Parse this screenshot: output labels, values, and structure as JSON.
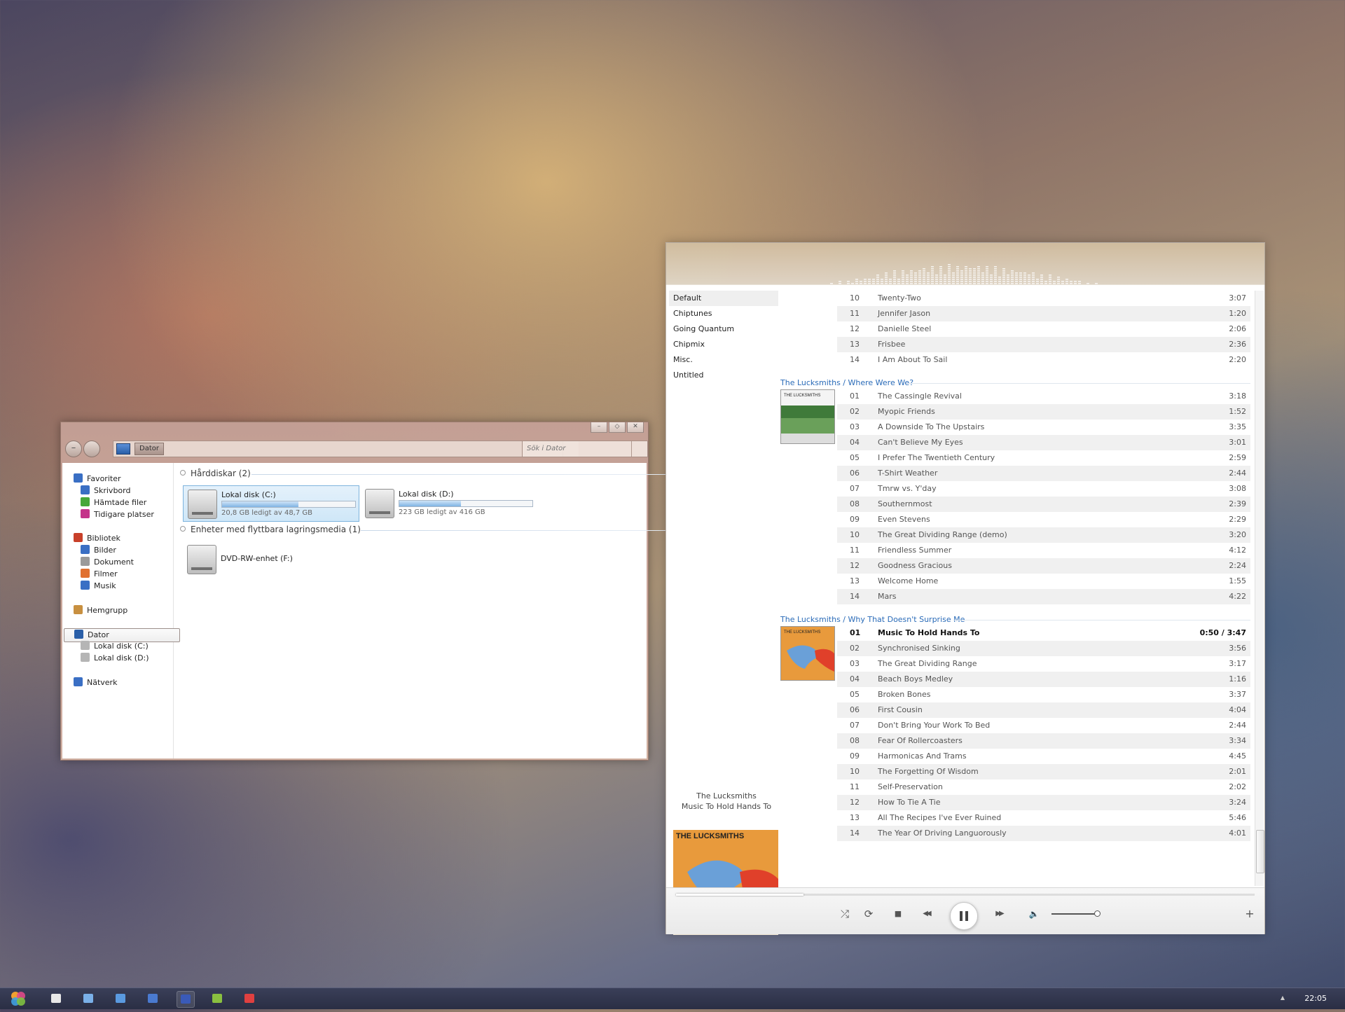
{
  "explorer": {
    "window_buttons": [
      "–",
      "◇",
      "✕"
    ],
    "breadcrumb": "Dator",
    "search_placeholder": "Sök i Dator",
    "nav": [
      {
        "label": "Favoriter",
        "icon": "star-icon",
        "color": "#3a6fc4",
        "indent": false
      },
      {
        "label": "Skrivbord",
        "icon": "desktop-icon",
        "color": "#3a6fc4",
        "indent": true
      },
      {
        "label": "Hämtade filer",
        "icon": "download-icon",
        "color": "#46a83a",
        "indent": true
      },
      {
        "label": "Tidigare platser",
        "icon": "recent-places-icon",
        "color": "#c4338a",
        "indent": true
      },
      {
        "label": "Bibliotek",
        "icon": "library-icon",
        "color": "#c8402a",
        "indent": false
      },
      {
        "label": "Bilder",
        "icon": "pictures-icon",
        "color": "#3a6fc4",
        "indent": true
      },
      {
        "label": "Dokument",
        "icon": "documents-icon",
        "color": "#9a9a9a",
        "indent": true
      },
      {
        "label": "Filmer",
        "icon": "videos-icon",
        "color": "#e07030",
        "indent": true
      },
      {
        "label": "Musik",
        "icon": "music-icon",
        "color": "#3a6fc4",
        "indent": true
      },
      {
        "label": "Hemgrupp",
        "icon": "homegroup-icon",
        "color": "#c89040",
        "indent": false
      },
      {
        "label": "Dator",
        "icon": "computer-icon",
        "color": "#2a5fa8",
        "indent": false,
        "selected": true
      },
      {
        "label": "Lokal disk (C:)",
        "icon": "drive-icon",
        "color": "#b5b5b5",
        "indent": true
      },
      {
        "label": "Lokal disk (D:)",
        "icon": "drive-icon",
        "color": "#b5b5b5",
        "indent": true
      },
      {
        "label": "Nätverk",
        "icon": "network-icon",
        "color": "#3a6fc4",
        "indent": false
      }
    ],
    "groups": {
      "hard_disks": "Hårddiskar (2)",
      "removable": "Enheter med flyttbara lagringsmedia (1)"
    },
    "drives": [
      {
        "name": "Lokal disk (C:)",
        "free": "20,8 GB ledigt av 48,7 GB",
        "used_fraction": 0.573
      },
      {
        "name": "Lokal disk (D:)",
        "free": "223 GB ledigt av 416 GB",
        "used_fraction": 0.464
      }
    ],
    "dvd": {
      "name": "DVD-RW-enhet (F:)"
    }
  },
  "player": {
    "playlists": [
      {
        "label": "Default",
        "active": true
      },
      {
        "label": "Chiptunes",
        "active": false
      },
      {
        "label": "Going Quantum",
        "active": false
      },
      {
        "label": "Chipmix",
        "active": false
      },
      {
        "label": "Misc.",
        "active": false
      },
      {
        "label": "Untitled",
        "active": false
      }
    ],
    "prev_album_tail": [
      {
        "n": "10",
        "title": "Twenty-Two",
        "dur": "3:07"
      },
      {
        "n": "11",
        "title": "Jennifer Jason",
        "dur": "1:20"
      },
      {
        "n": "12",
        "title": "Danielle Steel",
        "dur": "2:06"
      },
      {
        "n": "13",
        "title": "Frisbee",
        "dur": "2:36"
      },
      {
        "n": "14",
        "title": "I Am About To Sail",
        "dur": "2:20"
      }
    ],
    "albums": [
      {
        "heading": "The Lucksmiths / Where Were We?",
        "art_label": "THE LUCKSMITHS",
        "tracks": [
          {
            "n": "01",
            "title": "The Cassingle Revival",
            "dur": "3:18"
          },
          {
            "n": "02",
            "title": "Myopic Friends",
            "dur": "1:52"
          },
          {
            "n": "03",
            "title": "A Downside To The Upstairs",
            "dur": "3:35"
          },
          {
            "n": "04",
            "title": "Can't Believe My Eyes",
            "dur": "3:01"
          },
          {
            "n": "05",
            "title": "I Prefer The Twentieth Century",
            "dur": "2:59"
          },
          {
            "n": "06",
            "title": "T-Shirt Weather",
            "dur": "2:44"
          },
          {
            "n": "07",
            "title": "Tmrw vs. Y'day",
            "dur": "3:08"
          },
          {
            "n": "08",
            "title": "Southernmost",
            "dur": "2:39"
          },
          {
            "n": "09",
            "title": "Even Stevens",
            "dur": "2:29"
          },
          {
            "n": "10",
            "title": "The Great Dividing Range (demo)",
            "dur": "3:20"
          },
          {
            "n": "11",
            "title": "Friendless Summer",
            "dur": "4:12"
          },
          {
            "n": "12",
            "title": "Goodness Gracious",
            "dur": "2:24"
          },
          {
            "n": "13",
            "title": "Welcome Home",
            "dur": "1:55"
          },
          {
            "n": "14",
            "title": "Mars",
            "dur": "4:22"
          }
        ]
      },
      {
        "heading": "The Lucksmiths / Why That Doesn't Surprise Me",
        "art_label": "THE LUCKSMITHS",
        "tracks": [
          {
            "n": "01",
            "title": "Music To Hold Hands To",
            "dur": "0:50 / 3:47",
            "playing": true
          },
          {
            "n": "02",
            "title": "Synchronised Sinking",
            "dur": "3:56"
          },
          {
            "n": "03",
            "title": "The Great Dividing Range",
            "dur": "3:17"
          },
          {
            "n": "04",
            "title": "Beach Boys Medley",
            "dur": "1:16"
          },
          {
            "n": "05",
            "title": "Broken Bones",
            "dur": "3:37"
          },
          {
            "n": "06",
            "title": "First Cousin",
            "dur": "4:04"
          },
          {
            "n": "07",
            "title": "Don't Bring Your Work To Bed",
            "dur": "2:44"
          },
          {
            "n": "08",
            "title": "Fear Of Rollercoasters",
            "dur": "3:34"
          },
          {
            "n": "09",
            "title": "Harmonicas And Trams",
            "dur": "4:45"
          },
          {
            "n": "10",
            "title": "The Forgetting Of Wisdom",
            "dur": "2:01"
          },
          {
            "n": "11",
            "title": "Self-Preservation",
            "dur": "2:02"
          },
          {
            "n": "12",
            "title": "How To Tie A Tie",
            "dur": "3:24"
          },
          {
            "n": "13",
            "title": "All The Recipes I've Ever Ruined",
            "dur": "5:46"
          },
          {
            "n": "14",
            "title": "The Year Of Driving Languorously",
            "dur": "4:01"
          }
        ]
      }
    ],
    "now_playing": {
      "artist": "The Lucksmiths",
      "title": "Music To Hold Hands To",
      "art_label": "THE LUCKSMITHS",
      "progress": 0.22
    },
    "controls": {
      "shuffle": "⤮",
      "repeat": "⟳",
      "stop": "■",
      "prev": "◀◀",
      "next": "▶▶",
      "volume": "🔈",
      "add": "+",
      "volume_level": 1.0
    }
  },
  "taskbar": {
    "clock": "22:05",
    "apps": [
      {
        "name": "app-1-icon",
        "color": "#e8e8e8"
      },
      {
        "name": "app-2-icon",
        "color": "#7ab0e8"
      },
      {
        "name": "app-3-icon",
        "color": "#5a9ae0"
      },
      {
        "name": "app-4-icon",
        "color": "#4a7ad0"
      },
      {
        "name": "music-player-icon",
        "color": "#3a5ab8",
        "active": true
      },
      {
        "name": "app-6-icon",
        "color": "#8ac040"
      },
      {
        "name": "app-7-icon",
        "color": "#e04040"
      }
    ]
  }
}
